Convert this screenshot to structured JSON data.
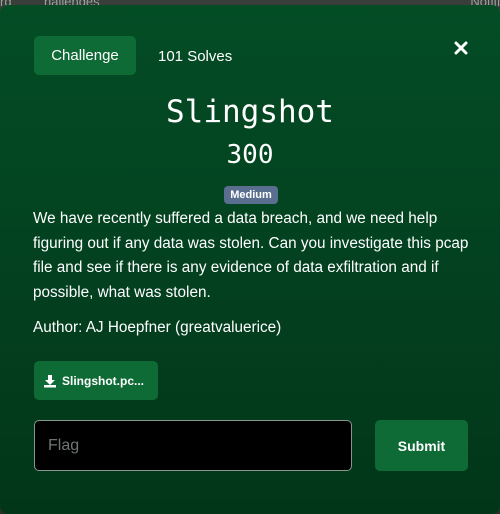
{
  "background": {
    "left_text": "rd",
    "tab_text": "hallenges",
    "right_text": "Notifi"
  },
  "modal": {
    "tabs": [
      {
        "label": "Challenge",
        "active": true
      },
      {
        "label": "101 Solves",
        "active": false
      }
    ],
    "close_icon": "close-icon",
    "title": "Slingshot",
    "value": "300",
    "difficulty": "Medium",
    "description": "We have recently suffered a data breach, and we need help figuring out if any data was stolen. Can you investigate this pcap file and see if there is any evidence of data exfiltration and if possible, what was stolen.",
    "author": "Author: AJ Hoepfner (greatvaluerice)",
    "file": {
      "label": "Slingshot.pc...",
      "icon": "download-icon"
    },
    "flag_input": {
      "placeholder": "Flag",
      "value": ""
    },
    "submit_label": "Submit"
  },
  "colors": {
    "modal_bg": "#034d25",
    "button_green": "#0f6b36",
    "badge": "#5a6f8f"
  }
}
